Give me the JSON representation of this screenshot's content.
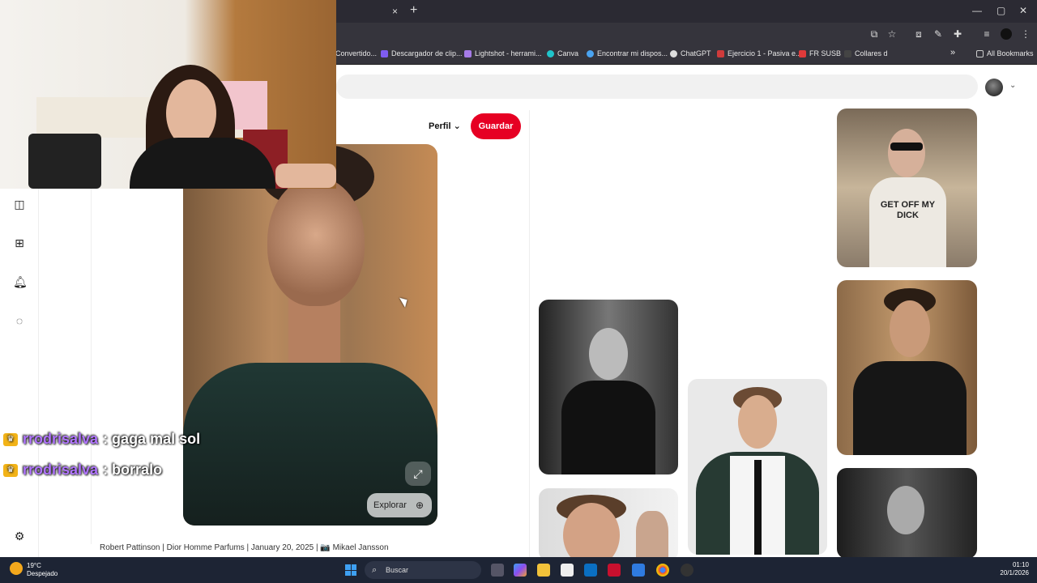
{
  "browser": {
    "tab_close": "×",
    "tab_new": "+",
    "bookmarks": [
      {
        "label": "Convertido...",
        "color": "#5a5a5a"
      },
      {
        "label": "Descargador de clip...",
        "color": "#7e5cf0"
      },
      {
        "label": "Lightshot - herrami...",
        "color": "#a67be8"
      },
      {
        "label": "Canva",
        "color": "#20c4cb"
      },
      {
        "label": "Encontrar mi dispos...",
        "color": "#4aa3f0"
      },
      {
        "label": "ChatGPT",
        "color": "#dddddd"
      },
      {
        "label": "Ejercicio 1 - Pasiva e...",
        "color": "#cf3b3b"
      },
      {
        "label": "FR SUSB",
        "color": "#e03a3a"
      },
      {
        "label": "Collares d",
        "color": "#444444"
      }
    ],
    "bookmarks_more": "»",
    "all_bookmarks": "All Bookmarks"
  },
  "page": {
    "perfil_label": "Perfil",
    "save_label": "Guardar",
    "explore_label": "Explorar",
    "caption": "Robert Pattinson | Dior Homme Parfums | January 20, 2025 | 📷 Mikael Jansson",
    "tshirt_text": "GET OFF MY DICK"
  },
  "chat": [
    {
      "user": "rrodrisalva",
      "message": ": gaga mal sol"
    },
    {
      "user": "rrodrisalva",
      "message": ": borralo"
    }
  ],
  "taskbar": {
    "temperature": "19°C",
    "weather": "Despejado",
    "search_placeholder": "Buscar",
    "time": "01:10",
    "date": "20/1/2026"
  },
  "colors": {
    "save_button": "#e60023",
    "chat_username": "#b175ff"
  }
}
